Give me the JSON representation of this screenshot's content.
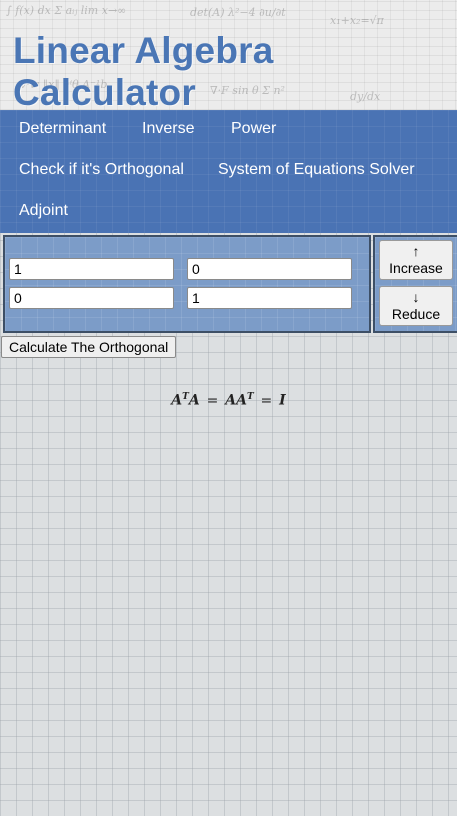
{
  "header": {
    "title": "Linear Algebra Calculator"
  },
  "nav": {
    "items": [
      {
        "label": "Determinant"
      },
      {
        "label": "Inverse"
      },
      {
        "label": "Power"
      },
      {
        "label": "Check if it's Orthogonal"
      },
      {
        "label": "System of Equations Solver"
      },
      {
        "label": "Adjoint"
      }
    ]
  },
  "matrix": {
    "cells": [
      [
        "1",
        "0"
      ],
      [
        "0",
        "1"
      ]
    ]
  },
  "controls": {
    "increase_arrow": "↑",
    "increase_label": "Increase",
    "reduce_arrow": "↓",
    "reduce_label": "Reduce"
  },
  "calculate_label": "Calculate The Orthogonal",
  "formula": {
    "a": "A",
    "t": "T",
    "eq": "=",
    "i": "I"
  },
  "colors": {
    "title": "#4a76b5",
    "nav_background": "#4a73b4",
    "panel_background": "#7c9cc8"
  }
}
